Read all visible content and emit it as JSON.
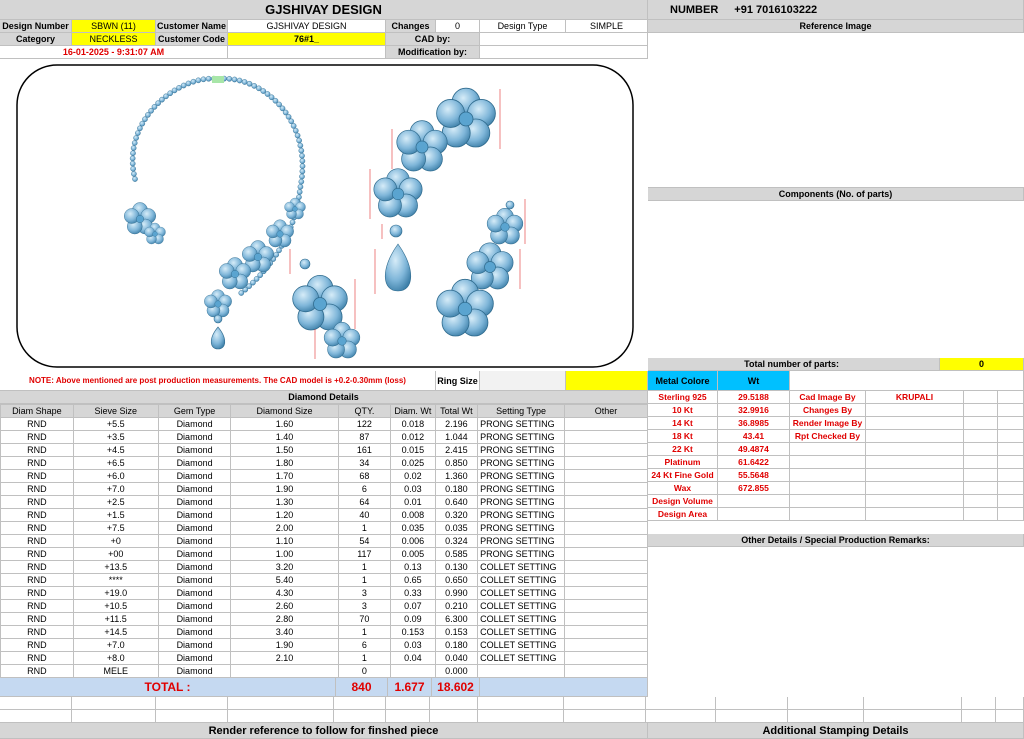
{
  "header": {
    "company": "GJSHIVAY DESIGN",
    "number_label": "NUMBER",
    "number_value": "+91 7016103222"
  },
  "info": {
    "design_number_label": "Design Number",
    "design_number": "SBWN (11)",
    "customer_name_label": "Customer Name",
    "customer_name": "GJSHIVAY DESIGN",
    "changes_label": "Changes",
    "changes": "0",
    "design_type_label": "Design Type",
    "design_type": "SIMPLE",
    "category_label": "Category",
    "category": "NECKLESS",
    "customer_code_label": "Customer Code",
    "customer_code": "76#1_",
    "cad_by_label": "CAD by:",
    "modification_by_label": "Modification by:",
    "timestamp": "16-01-2025 - 9:31:07 AM"
  },
  "right": {
    "reference_image": "Reference Image",
    "components": "Components (No. of parts)",
    "total_parts_label": "Total number of parts:",
    "total_parts": "0",
    "metal_color": "Metal Colore",
    "wt": "Wt",
    "other_details": "Other Details / Special Production Remarks:",
    "additional_stamping": "Additional Stamping Details"
  },
  "metals": [
    {
      "name": "Sterling 925",
      "wt": "29.5188",
      "role": "Cad Image By",
      "person": "KRUPALI"
    },
    {
      "name": "10 Kt",
      "wt": "32.9916",
      "role": "Changes By",
      "person": ""
    },
    {
      "name": "14 Kt",
      "wt": "36.8985",
      "role": "Render Image By",
      "person": ""
    },
    {
      "name": "18 Kt",
      "wt": "43.41",
      "role": "Rpt Checked By",
      "person": ""
    },
    {
      "name": "22 Kt",
      "wt": "49.4874",
      "role": "",
      "person": ""
    },
    {
      "name": "Platinum",
      "wt": "61.6422",
      "role": "",
      "person": ""
    },
    {
      "name": "24 Kt Fine Gold",
      "wt": "55.5648",
      "role": "",
      "person": ""
    },
    {
      "name": "Wax",
      "wt": "672.855",
      "role": "",
      "person": ""
    },
    {
      "name": "Design Volume",
      "wt": "",
      "role": "",
      "person": ""
    },
    {
      "name": "Design Area",
      "wt": "",
      "role": "",
      "person": ""
    }
  ],
  "note": "NOTE: Above mentioned are post production measurements. The CAD model is +0.2-0.30mm (loss)",
  "ring_size_label": "Ring Size",
  "diamond_details": {
    "title": "Diamond Details",
    "headers": [
      "Diam Shape",
      "Sieve Size",
      "Gem Type",
      "Diamond Size",
      "QTY.",
      "Diam. Wt",
      "Total Wt",
      "Setting Type",
      "Other"
    ],
    "rows": [
      [
        "RND",
        "+5.5",
        "Diamond",
        "1.60",
        "122",
        "0.018",
        "2.196",
        "PRONG SETTING",
        ""
      ],
      [
        "RND",
        "+3.5",
        "Diamond",
        "1.40",
        "87",
        "0.012",
        "1.044",
        "PRONG SETTING",
        ""
      ],
      [
        "RND",
        "+4.5",
        "Diamond",
        "1.50",
        "161",
        "0.015",
        "2.415",
        "PRONG SETTING",
        ""
      ],
      [
        "RND",
        "+6.5",
        "Diamond",
        "1.80",
        "34",
        "0.025",
        "0.850",
        "PRONG SETTING",
        ""
      ],
      [
        "RND",
        "+6.0",
        "Diamond",
        "1.70",
        "68",
        "0.02",
        "1.360",
        "PRONG SETTING",
        ""
      ],
      [
        "RND",
        "+7.0",
        "Diamond",
        "1.90",
        "6",
        "0.03",
        "0.180",
        "PRONG SETTING",
        ""
      ],
      [
        "RND",
        "+2.5",
        "Diamond",
        "1.30",
        "64",
        "0.01",
        "0.640",
        "PRONG SETTING",
        ""
      ],
      [
        "RND",
        "+1.5",
        "Diamond",
        "1.20",
        "40",
        "0.008",
        "0.320",
        "PRONG SETTING",
        ""
      ],
      [
        "RND",
        "+7.5",
        "Diamond",
        "2.00",
        "1",
        "0.035",
        "0.035",
        "PRONG SETTING",
        ""
      ],
      [
        "RND",
        "+0",
        "Diamond",
        "1.10",
        "54",
        "0.006",
        "0.324",
        "PRONG SETTING",
        ""
      ],
      [
        "RND",
        "+00",
        "Diamond",
        "1.00",
        "117",
        "0.005",
        "0.585",
        "PRONG SETTING",
        ""
      ],
      [
        "RND",
        "+13.5",
        "Diamond",
        "3.20",
        "1",
        "0.13",
        "0.130",
        "COLLET SETTING",
        ""
      ],
      [
        "RND",
        "****",
        "Diamond",
        "5.40",
        "1",
        "0.65",
        "0.650",
        "COLLET SETTING",
        ""
      ],
      [
        "RND",
        "+19.0",
        "Diamond",
        "4.30",
        "3",
        "0.33",
        "0.990",
        "COLLET SETTING",
        ""
      ],
      [
        "RND",
        "+10.5",
        "Diamond",
        "2.60",
        "3",
        "0.07",
        "0.210",
        "COLLET SETTING",
        ""
      ],
      [
        "RND",
        "+11.5",
        "Diamond",
        "2.80",
        "70",
        "0.09",
        "6.300",
        "COLLET SETTING",
        ""
      ],
      [
        "RND",
        "+14.5",
        "Diamond",
        "3.40",
        "1",
        "0.153",
        "0.153",
        "COLLET SETTING",
        ""
      ],
      [
        "RND",
        "+7.0",
        "Diamond",
        "1.90",
        "6",
        "0.03",
        "0.180",
        "COLLET SETTING",
        ""
      ],
      [
        "RND",
        "+8.0",
        "Diamond",
        "2.10",
        "1",
        "0.04",
        "0.040",
        "COLLET SETTING",
        ""
      ],
      [
        "RND",
        "MELE",
        "Diamond",
        "",
        "0",
        "",
        "0.000",
        "",
        ""
      ]
    ],
    "total_label": "TOTAL :",
    "total_qty": "840",
    "total_diam_wt": "1.677",
    "total_wt": "18.602"
  },
  "footer": {
    "render_reference": "Render reference to follow for finshed piece"
  },
  "colors": {
    "header_gray": "#d6d6d6",
    "highlight_yellow": "#ffff00",
    "total_blue": "#c5d9f1",
    "metal_header_cyan": "#00c0ff",
    "red_text": "#e00000",
    "gem_blue": "#7fb6d9"
  }
}
